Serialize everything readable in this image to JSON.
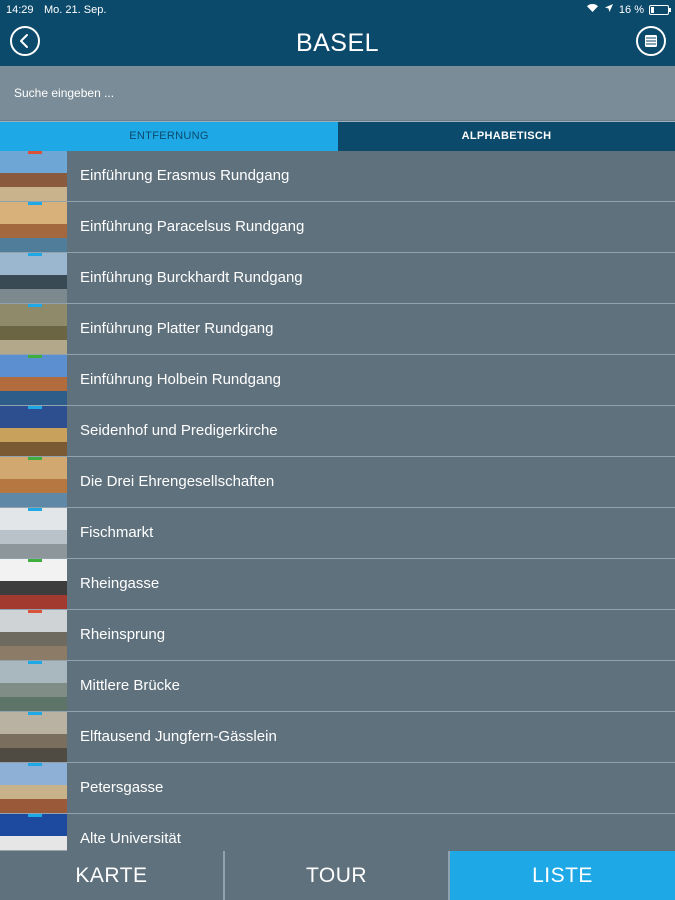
{
  "statusbar": {
    "time": "14:29",
    "date": "Mo. 21. Sep.",
    "battery": "16 %"
  },
  "header": {
    "title": "BASEL"
  },
  "search": {
    "placeholder": "Suche eingeben ..."
  },
  "sort_tabs": {
    "distance": "ENTFERNUNG",
    "alphabetical": "ALPHABETISCH",
    "active": "distance"
  },
  "items": [
    {
      "label": "Einführung Erasmus Rundgang",
      "marker": "#d9533a",
      "sky": "#6ea6d6",
      "mid": "#8a5a3c",
      "ground": "#c9b38c"
    },
    {
      "label": "Einführung Paracelsus Rundgang",
      "marker": "#1ea8e6",
      "sky": "#d7b07a",
      "mid": "#a4683e",
      "ground": "#4f7d9a"
    },
    {
      "label": "Einführung Burckhardt Rundgang",
      "marker": "#1ea8e6",
      "sky": "#9ab7cf",
      "mid": "#3a4a55",
      "ground": "#7c8a90"
    },
    {
      "label": "Einführung Platter Rundgang",
      "marker": "#1ea8e6",
      "sky": "#8f8a6a",
      "mid": "#6b6544",
      "ground": "#b3a98a"
    },
    {
      "label": "Einführung Holbein Rundgang",
      "marker": "#3fae3f",
      "sky": "#5b8fd0",
      "mid": "#b26b3c",
      "ground": "#2e5d8a"
    },
    {
      "label": "Seidenhof und Predigerkirche",
      "marker": "#1ea8e6",
      "sky": "#2d4f8f",
      "mid": "#c8a25c",
      "ground": "#7a5a32"
    },
    {
      "label": "Die Drei Ehrengesellschaften",
      "marker": "#3fae3f",
      "sky": "#d2a871",
      "mid": "#b77741",
      "ground": "#5f87a6"
    },
    {
      "label": "Fischmarkt",
      "marker": "#1ea8e6",
      "sky": "#e3e6e8",
      "mid": "#b9c2c8",
      "ground": "#8d969b"
    },
    {
      "label": "Rheingasse",
      "marker": "#3fae3f",
      "sky": "#f2f2f2",
      "mid": "#3d3d3d",
      "ground": "#a33a2f"
    },
    {
      "label": "Rheinsprung",
      "marker": "#d9533a",
      "sky": "#cfd3d6",
      "mid": "#6e6a60",
      "ground": "#8c7b66"
    },
    {
      "label": "Mittlere Brücke",
      "marker": "#1ea8e6",
      "sky": "#a9b8bf",
      "mid": "#7f8d86",
      "ground": "#5d7468"
    },
    {
      "label": "Elftausend Jungfern-Gässlein",
      "marker": "#1ea8e6",
      "sky": "#b9b2a3",
      "mid": "#7a6f5f",
      "ground": "#4f4a42"
    },
    {
      "label": "Petersgasse",
      "marker": "#1ea8e6",
      "sky": "#8fb0d6",
      "mid": "#c7b28a",
      "ground": "#9a5a3a"
    },
    {
      "label": "Alte Universität",
      "marker": "#1ea8e6",
      "sky": "#1d4a9e",
      "mid": "#e6e6e6",
      "ground": "#9aa2a8"
    }
  ],
  "bottombar": {
    "karte": "KARTE",
    "tour": "TOUR",
    "liste": "LISTE",
    "active": "liste"
  },
  "colors": {
    "header_bg": "#0c4a6c",
    "accent": "#1ea8e6",
    "row_bg": "#5f717d",
    "search_bg": "#7a8c97"
  }
}
